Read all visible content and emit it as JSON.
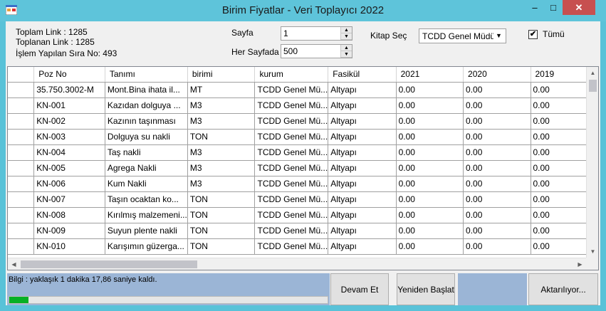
{
  "window": {
    "title": "Birim Fiyatlar - Veri Toplayıcı 2022",
    "min": "–",
    "max": "□",
    "close": "✕"
  },
  "stats": {
    "total_links": "Toplam Link : 1285",
    "collected_links": "Toplanan Link : 1285",
    "processed": "İşlem Yapılan Sıra No: 493"
  },
  "controls": {
    "page_label": "Sayfa",
    "page_value": "1",
    "per_page_label": "Her Sayfada",
    "per_page_value": "500",
    "book_label": "Kitap Seç",
    "book_value": "TCDD Genel Müdürlü",
    "all_label": "Tümü",
    "all_checked": true
  },
  "grid": {
    "columns": [
      "Poz No",
      "Tanımı",
      "birimi",
      "kurum",
      "Fasikül",
      "2021",
      "2020",
      "2019"
    ],
    "rows": [
      [
        "35.750.3002-M",
        "Mont.Bina ihata il...",
        "MT",
        "TCDD Genel Mü...",
        "Altyapı",
        "0.00",
        "0.00",
        "0.00"
      ],
      [
        "KN-001",
        "Kazıdan dolguya ...",
        "M3",
        "TCDD Genel Mü...",
        "Altyapı",
        "0.00",
        "0.00",
        "0.00"
      ],
      [
        "KN-002",
        "Kazının taşınması",
        "M3",
        "TCDD Genel Mü...",
        "Altyapı",
        "0.00",
        "0.00",
        "0.00"
      ],
      [
        "KN-003",
        "Dolguya su nakli",
        "TON",
        "TCDD Genel Mü...",
        "Altyapı",
        "0.00",
        "0.00",
        "0.00"
      ],
      [
        "KN-004",
        "Taş nakli",
        "M3",
        "TCDD Genel Mü...",
        "Altyapı",
        "0.00",
        "0.00",
        "0.00"
      ],
      [
        "KN-005",
        "Agrega Nakli",
        "M3",
        "TCDD Genel Mü...",
        "Altyapı",
        "0.00",
        "0.00",
        "0.00"
      ],
      [
        "KN-006",
        "Kum Nakli",
        "M3",
        "TCDD Genel Mü...",
        "Altyapı",
        "0.00",
        "0.00",
        "0.00"
      ],
      [
        "KN-007",
        "Taşın ocaktan ko...",
        "TON",
        "TCDD Genel Mü...",
        "Altyapı",
        "0.00",
        "0.00",
        "0.00"
      ],
      [
        "KN-008",
        "Kırılmış malzemeni...",
        "TON",
        "TCDD Genel Mü...",
        "Altyapı",
        "0.00",
        "0.00",
        "0.00"
      ],
      [
        "KN-009",
        "Suyun plente nakli",
        "TON",
        "TCDD Genel Mü...",
        "Altyapı",
        "0.00",
        "0.00",
        "0.00"
      ],
      [
        "KN-010",
        "Karışımın güzerga...",
        "TON",
        "TCDD Genel Mü...",
        "Altyapı",
        "0.00",
        "0.00",
        "0.00"
      ]
    ]
  },
  "status": {
    "message": "Bilgi : yaklaşık 1 dakika 17,86 saniye kaldı.",
    "progress": 0.06
  },
  "buttons": {
    "continue": "Devam Et",
    "restart": "Yeniden Başlat",
    "transferring": "Aktarılıyor..."
  },
  "colors": {
    "title_bar": "#5ec4da",
    "status_panel": "#9bb5d6",
    "progress_fill": "#06b025",
    "close_button": "#c75050"
  }
}
